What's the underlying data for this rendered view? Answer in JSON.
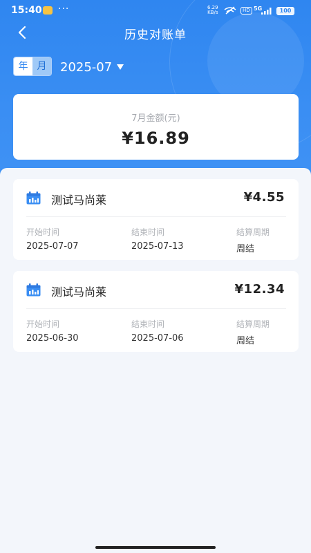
{
  "status_bar": {
    "time": "15:40",
    "dots": "···",
    "speed_value": "6.29",
    "speed_unit": "KB/s",
    "hd": "HD",
    "network": "5G",
    "battery": "100"
  },
  "nav": {
    "title": "历史对账单"
  },
  "filter": {
    "year_label": "年",
    "month_label": "月",
    "selected_period": "2025-07"
  },
  "summary": {
    "label": "7月金额(元)",
    "amount": "¥16.89"
  },
  "records": [
    {
      "name": "测试马尚莱",
      "amount": "¥4.55",
      "fields": [
        {
          "label": "开始时间",
          "value": "2025-07-07"
        },
        {
          "label": "结束时间",
          "value": "2025-07-13"
        },
        {
          "label": "结算周期",
          "value": "周结"
        }
      ]
    },
    {
      "name": "测试马尚莱",
      "amount": "¥12.34",
      "fields": [
        {
          "label": "开始时间",
          "value": "2025-06-30"
        },
        {
          "label": "结束时间",
          "value": "2025-07-06"
        },
        {
          "label": "结算周期",
          "value": "周结"
        }
      ]
    }
  ],
  "colors": {
    "primary": "#2f86f0",
    "icon_blue": "#3a8ef3"
  },
  "icons": {
    "back": "chevron-left-icon",
    "caret": "caret-down-icon",
    "record": "calendar-icon"
  }
}
